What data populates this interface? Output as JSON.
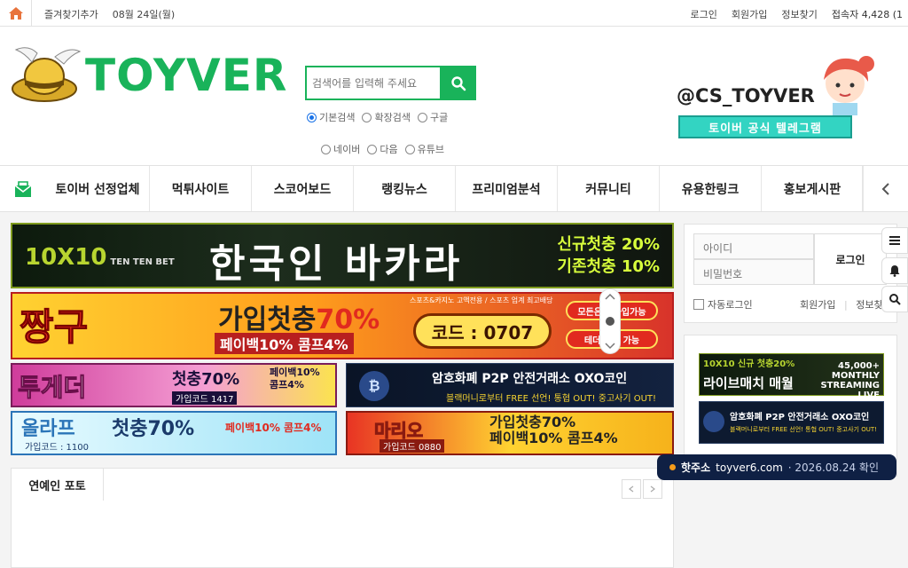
{
  "topbar": {
    "bookmark": "즐겨찾기추가",
    "date": "08월 24일(월)",
    "login": "로그인",
    "signup": "회원가입",
    "find": "정보찾기",
    "visitors": "접속자 4,428 (1"
  },
  "header": {
    "logo": "TOYVER",
    "search_placeholder": "검색어를 입력해 주세요",
    "radios_row1": [
      "기본검색",
      "확장검색",
      "구글"
    ],
    "radios_row2": [
      "네이버",
      "다음",
      "유튜브"
    ],
    "telegram_handle": "@CS_TOYVER",
    "telegram_button": "토이버 공식 텔레그램"
  },
  "nav": {
    "items": [
      "토이버 선정업체",
      "먹튀사이트",
      "스코어보드",
      "랭킹뉴스",
      "프리미엄분석",
      "커뮤니티",
      "유용한링크",
      "홍보게시판"
    ]
  },
  "banners": {
    "b1": {
      "logo": "10X10",
      "logo_sub": "TEN TEN BET",
      "title": "한국인 바카라",
      "side1": "신규첫충 20%",
      "side2": "기존첫충 10%"
    },
    "b2": {
      "left": "짱구",
      "title_a": "가입첫충",
      "title_b": "70%",
      "sub": "페이백10% 콤프4%",
      "code": "코드 : 0707",
      "small": "스포츠&카지노 고액전용 / 스포츠 업계 최고배당",
      "pill1": "모든은행 가입가능",
      "pill2": "테더 입금 가능"
    },
    "b3": {
      "left": "투게더",
      "main": "첫충70%",
      "right1": "페이백10%",
      "right2": "콤프4%",
      "code": "가입코드 1417"
    },
    "b4": {
      "coin": "₿",
      "title": "암호화폐 P2P 안전거래소 OXO코인",
      "sub": "블랙머니로부터 FREE 선언! 통협 OUT! 중고사기 OUT!"
    },
    "b5": {
      "left": "올라프",
      "code": "가입코드 : 1100",
      "main": "첫충70%",
      "right": "페이백10% 콤프4%"
    },
    "b6": {
      "left": "마리오",
      "code": "가입코드 0880",
      "line1": "가입첫충70%",
      "line2": "페이백10% 콤프4%"
    }
  },
  "section": {
    "tab": "연예인 포토"
  },
  "login": {
    "id_placeholder": "아이디",
    "pw_placeholder": "비밀번호",
    "button": "로그인",
    "auto": "자동로그인",
    "signup": "회원가입",
    "find": "정보찾기"
  },
  "side_ad": {
    "s1_top": "10X10 신규 첫충20%",
    "s1_main": "라이브매치 매월",
    "s1_right": "45,000+ MONTHLY STREAMING LIVE",
    "s2_main": "암호화폐 P2P 안전거래소 OXO코인",
    "s2_sub": "블랙머니로부터 FREE 선언! 통협 OUT! 중고사기 OUT!"
  },
  "toast": {
    "label": "핫주소",
    "domain": "toyver6.com",
    "date": "· 2026.08.24 확인"
  },
  "colors": {
    "brand": "#19b35a",
    "toast_bg": "#0f2044"
  }
}
